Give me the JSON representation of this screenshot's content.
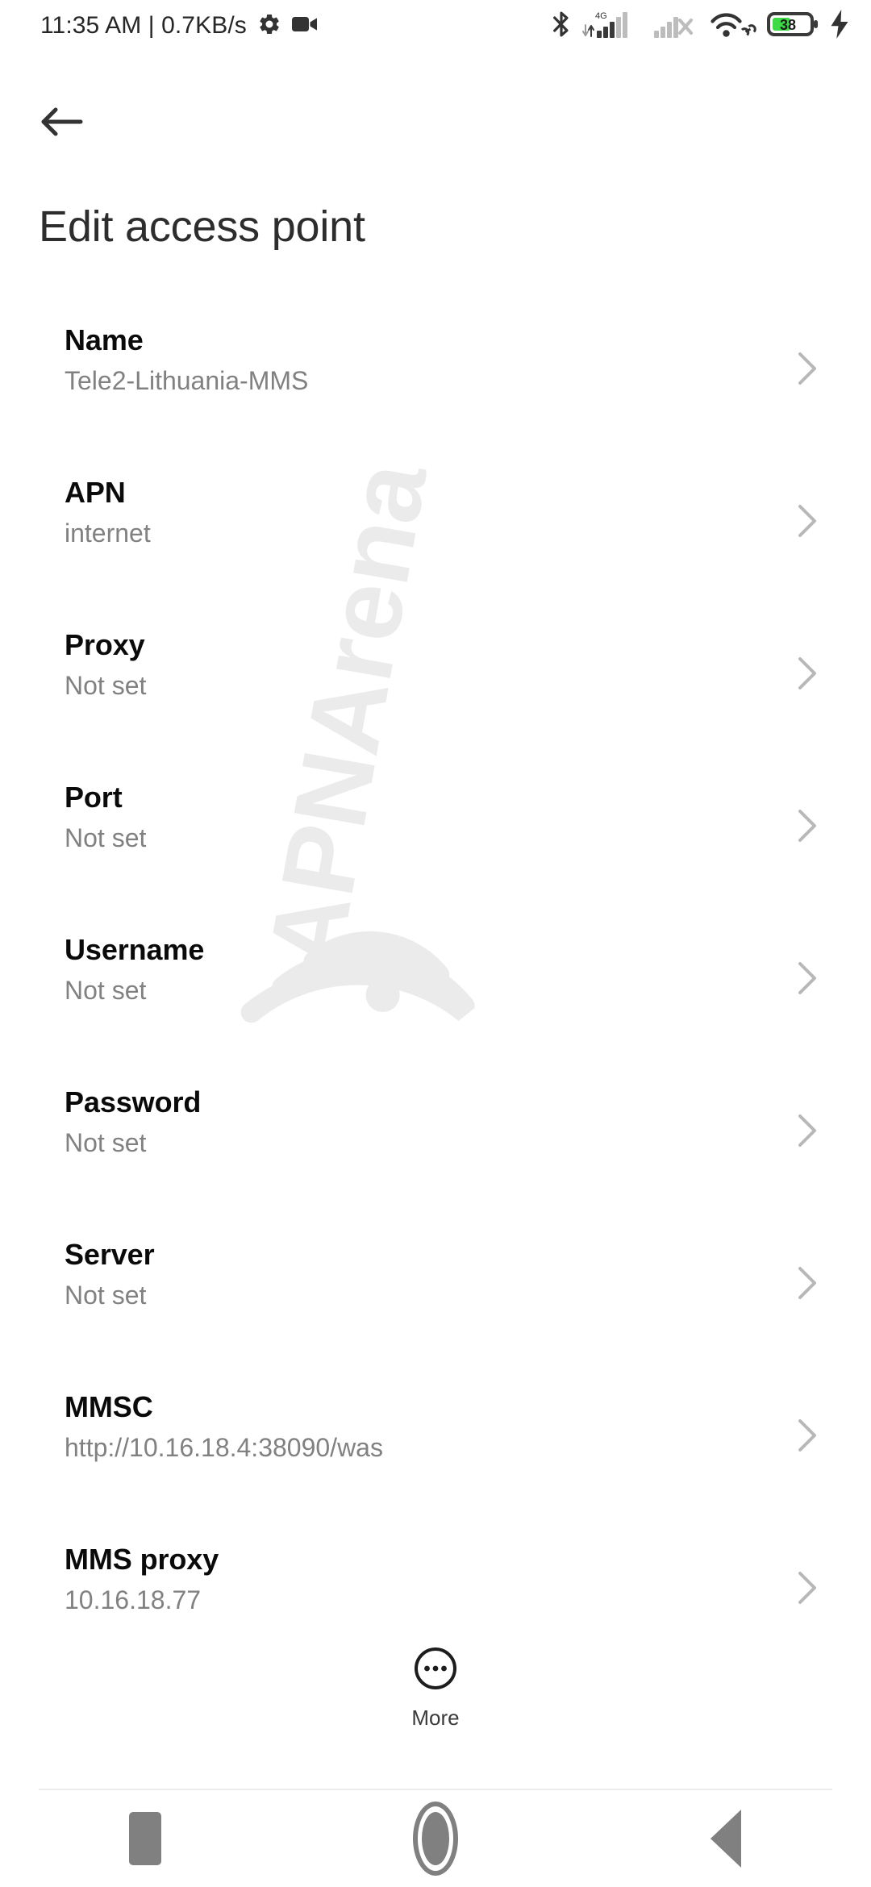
{
  "status_bar": {
    "time": "11:35 AM",
    "separator": "|",
    "network_speed": "0.7KB/s",
    "clock_text": "11:35 AM | 0.7KB/s",
    "icons_left": [
      "gear-icon",
      "video-camera-icon"
    ],
    "icons_right": [
      "bluetooth-icon",
      "signal-4g-icon",
      "signal-sim2-no-service-icon",
      "wifi-vpn-icon",
      "battery-icon",
      "charging-bolt-icon"
    ],
    "network_type": "4G",
    "battery_percent": "38",
    "battery_color": "#3ddc46",
    "icon_color": "#3a3a3a"
  },
  "header": {
    "back_icon": "arrow-left-icon",
    "title": "Edit access point"
  },
  "watermark": {
    "text": "APNArena",
    "color": "#ebebeb"
  },
  "settings": {
    "rows": [
      {
        "label": "Name",
        "value": "Tele2-Lithuania-MMS"
      },
      {
        "label": "APN",
        "value": "internet"
      },
      {
        "label": "Proxy",
        "value": "Not set"
      },
      {
        "label": "Port",
        "value": "Not set"
      },
      {
        "label": "Username",
        "value": "Not set"
      },
      {
        "label": "Password",
        "value": "Not set"
      },
      {
        "label": "Server",
        "value": "Not set"
      },
      {
        "label": "MMSC",
        "value": "http://10.16.18.4:38090/was"
      },
      {
        "label": "MMS proxy",
        "value": "10.16.18.77"
      }
    ]
  },
  "more": {
    "label": "More",
    "icon": "overflow-circle-icon"
  },
  "nav_bar": {
    "recents_label": "Recents",
    "home_label": "Home",
    "back_label": "Back",
    "color": "#808080"
  }
}
